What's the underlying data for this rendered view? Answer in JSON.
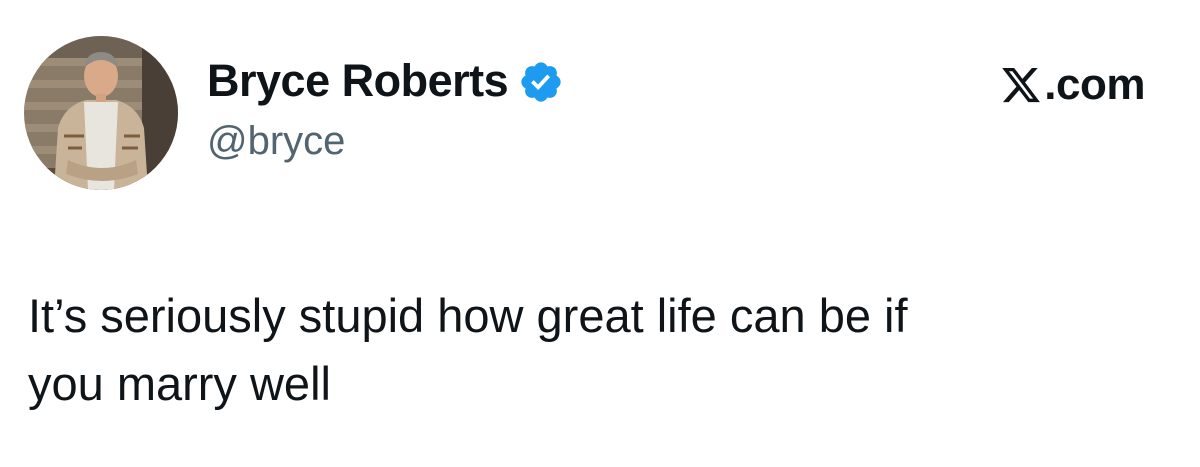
{
  "author": {
    "display_name": "Bryce Roberts",
    "handle": "@bryce",
    "verified": true,
    "avatar_icon": "user-avatar-photo",
    "verified_icon": "verified-badge-icon"
  },
  "site": {
    "logo_icon": "x-logo-icon",
    "domain": ".com"
  },
  "tweet": {
    "text": "It’s seriously stupid how great life can be if\nyou marry well"
  },
  "colors": {
    "text_primary": "#0f1419",
    "text_secondary": "#536471",
    "verified_blue": "#1d9bf0",
    "background": "#ffffff"
  }
}
